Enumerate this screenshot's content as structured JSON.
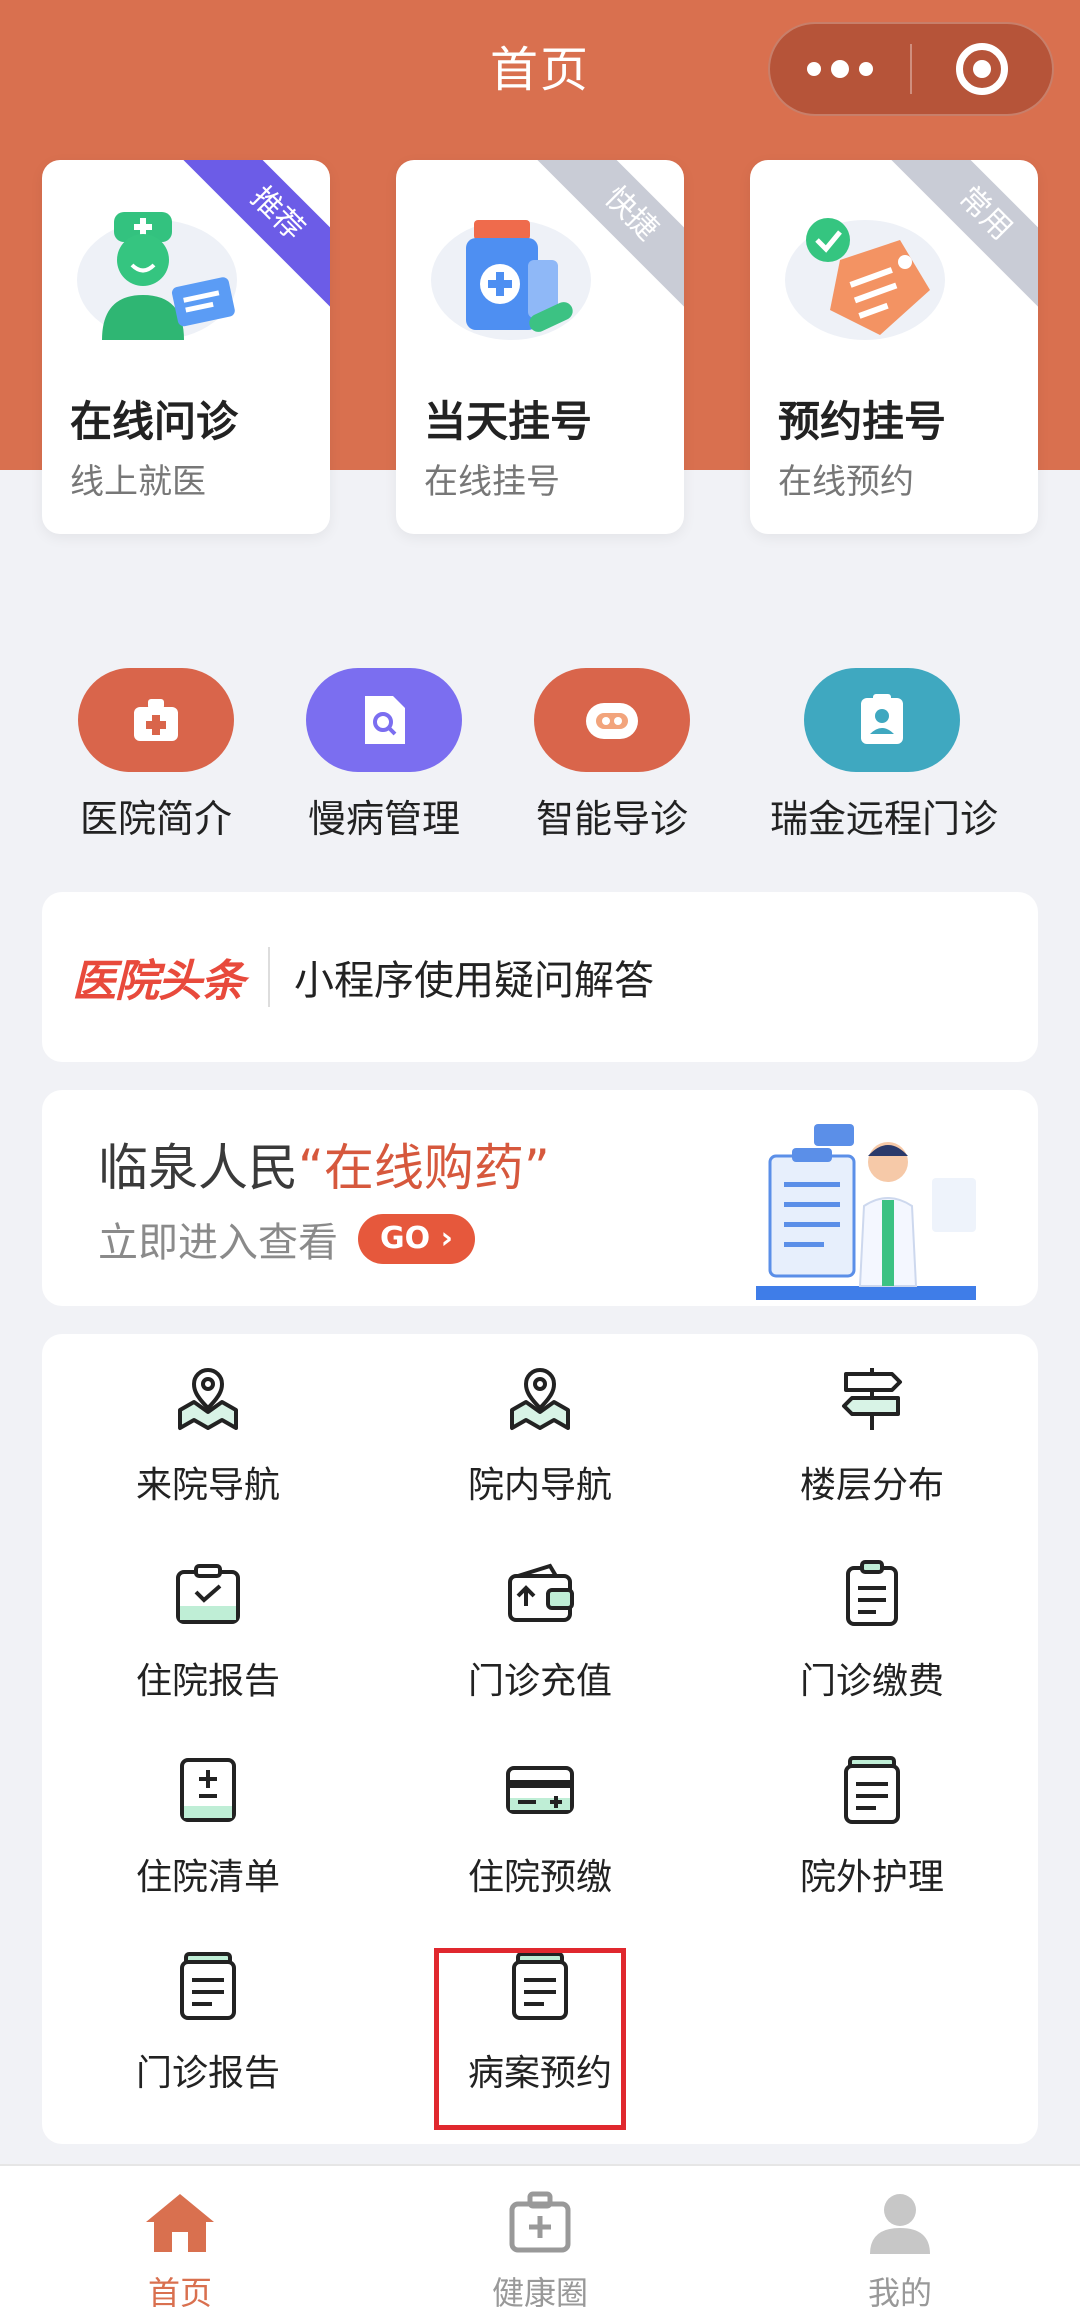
{
  "header": {
    "title": "首页"
  },
  "top_cards": [
    {
      "title": "在线问诊",
      "subtitle": "线上就医",
      "ribbon": "推荐",
      "ribbon_color": "#6c5ce7"
    },
    {
      "title": "当天挂号",
      "subtitle": "在线挂号",
      "ribbon": "快捷",
      "ribbon_color": "#c9ccd6"
    },
    {
      "title": "预约挂号",
      "subtitle": "在线预约",
      "ribbon": "常用",
      "ribbon_color": "#c9ccd6"
    }
  ],
  "shortcuts": [
    {
      "label": "医院简介",
      "color": "#d9654b"
    },
    {
      "label": "慢病管理",
      "color": "#7b6ef0"
    },
    {
      "label": "智能导诊",
      "color": "#d9654b"
    },
    {
      "label": "瑞金远程门诊",
      "color": "#3fa8c0"
    }
  ],
  "news": {
    "logo": "医院头条",
    "text": "小程序使用疑问解答"
  },
  "banner": {
    "line1_prefix": "临泉人民",
    "line1_highlight": "“在线购药”",
    "line2": "立即进入查看",
    "go": "GO ›"
  },
  "grid": [
    {
      "label": "来院导航",
      "icon": "map-pin-icon"
    },
    {
      "label": "院内导航",
      "icon": "map-pin-icon"
    },
    {
      "label": "楼层分布",
      "icon": "signpost-icon"
    },
    {
      "label": "住院报告",
      "icon": "check-tray-icon"
    },
    {
      "label": "门诊充值",
      "icon": "wallet-icon"
    },
    {
      "label": "门诊缴费",
      "icon": "clipboard-icon"
    },
    {
      "label": "住院清单",
      "icon": "plus-minus-doc-icon"
    },
    {
      "label": "住院预缴",
      "icon": "card-icon"
    },
    {
      "label": "院外护理",
      "icon": "document-icon"
    },
    {
      "label": "门诊报告",
      "icon": "document-icon"
    },
    {
      "label": "病案预约",
      "icon": "document-icon"
    }
  ],
  "tabbar": [
    {
      "label": "首页",
      "icon": "home-icon",
      "active": true
    },
    {
      "label": "健康圈",
      "icon": "medical-kit-icon",
      "active": false
    },
    {
      "label": "我的",
      "icon": "user-icon",
      "active": false
    }
  ],
  "colors": {
    "brand": "#d9704f",
    "accent_green": "#2bb673",
    "highlight_box": "#e0282e"
  }
}
